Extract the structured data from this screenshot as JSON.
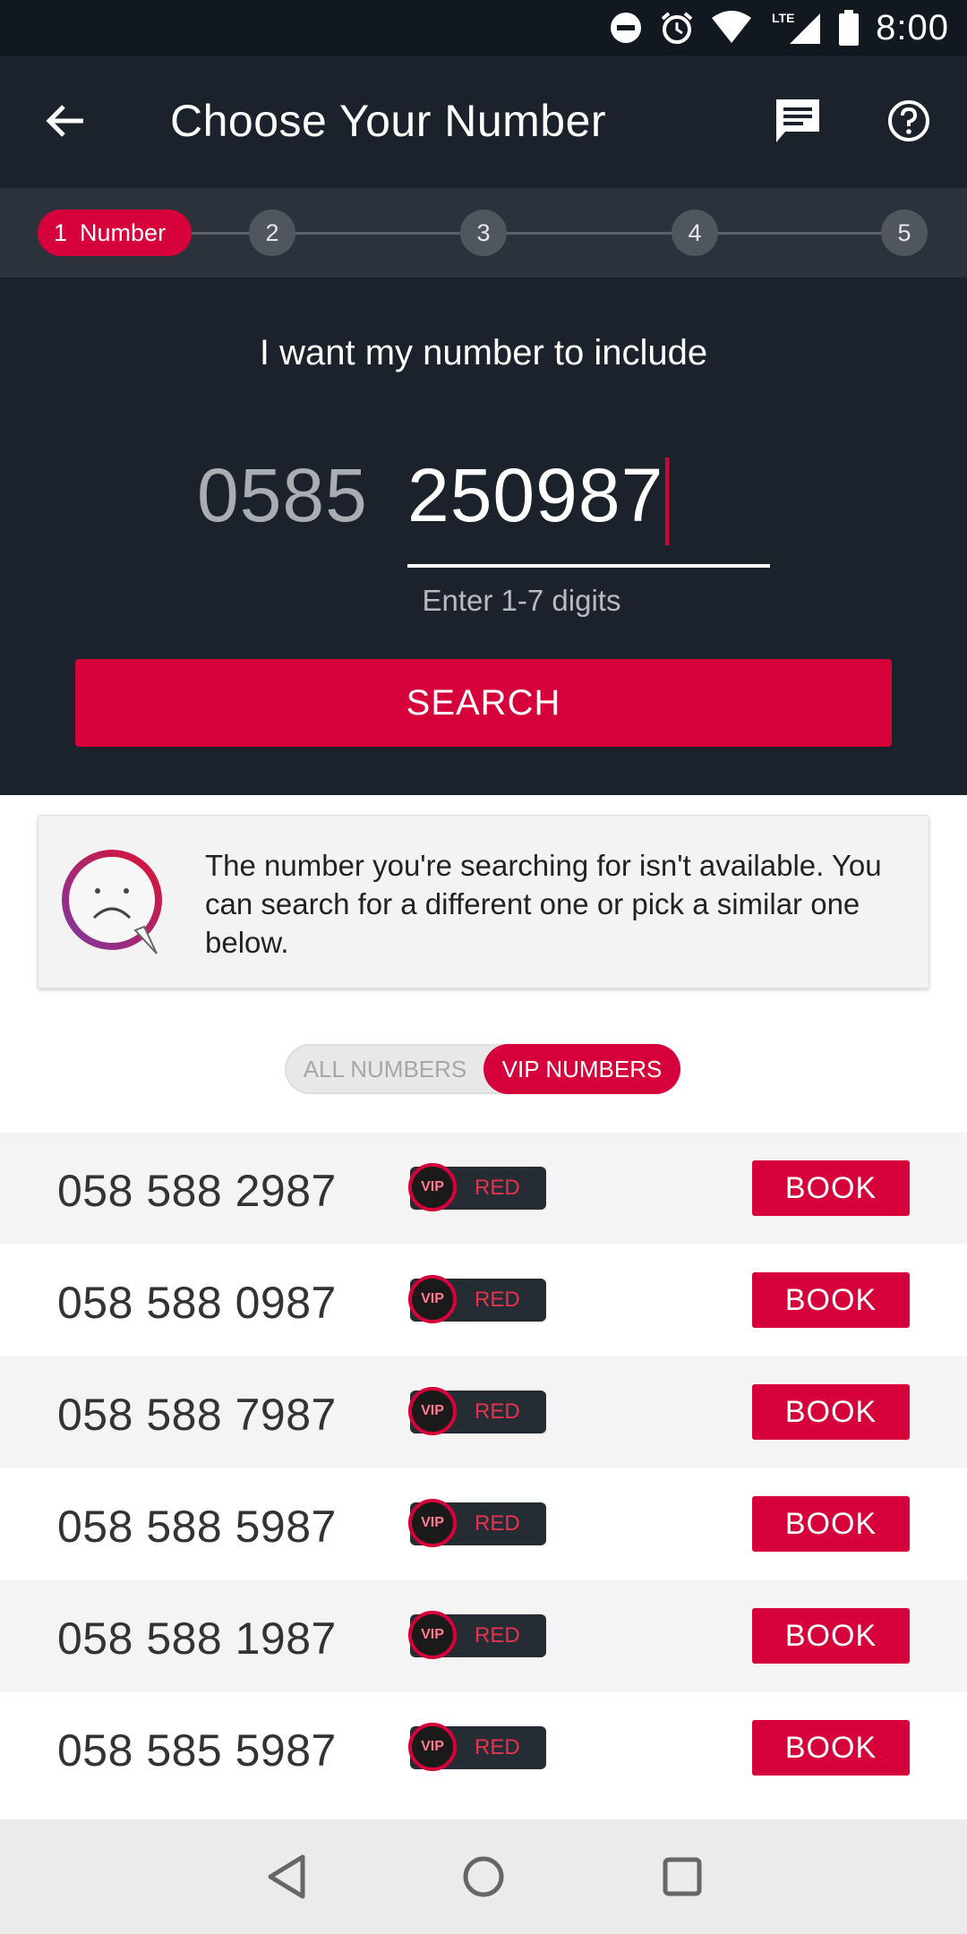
{
  "status_bar": {
    "time": "8:00",
    "network": "LTE"
  },
  "app_bar": {
    "title": "Choose Your Number"
  },
  "stepper": {
    "active_step": {
      "number": "1",
      "label": "Number"
    },
    "steps": [
      "2",
      "3",
      "4",
      "5"
    ]
  },
  "search": {
    "prompt": "I want my number to include",
    "prefix": "0585",
    "value": "250987",
    "hint": "Enter 1-7 digits",
    "button_label": "SEARCH"
  },
  "message": {
    "text": "The number you're searching for isn't available. You can search for a different one or pick a similar one below."
  },
  "filter": {
    "all_label": "ALL NUMBERS",
    "vip_label": "VIP NUMBERS",
    "selected": "VIP NUMBERS"
  },
  "numbers": [
    {
      "number": "058 588 2987",
      "badge_icon": "VIP",
      "tier": "RED",
      "action": "BOOK"
    },
    {
      "number": "058 588 0987",
      "badge_icon": "VIP",
      "tier": "RED",
      "action": "BOOK"
    },
    {
      "number": "058 588 7987",
      "badge_icon": "VIP",
      "tier": "RED",
      "action": "BOOK"
    },
    {
      "number": "058 588 5987",
      "badge_icon": "VIP",
      "tier": "RED",
      "action": "BOOK"
    },
    {
      "number": "058 588 1987",
      "badge_icon": "VIP",
      "tier": "RED",
      "action": "BOOK"
    },
    {
      "number": "058 585 5987",
      "badge_icon": "VIP",
      "tier": "RED",
      "action": "BOOK"
    }
  ],
  "colors": {
    "accent": "#d6003a",
    "header_bg": "#1b222b",
    "stepper_bg": "#2b323b"
  },
  "icons": {
    "back": "arrow-left-icon",
    "chat": "chat-icon",
    "help": "help-icon",
    "sad_face": "sad-face-icon",
    "nav_back": "nav-back-icon",
    "nav_home": "nav-home-icon",
    "nav_recents": "nav-recents-icon"
  }
}
